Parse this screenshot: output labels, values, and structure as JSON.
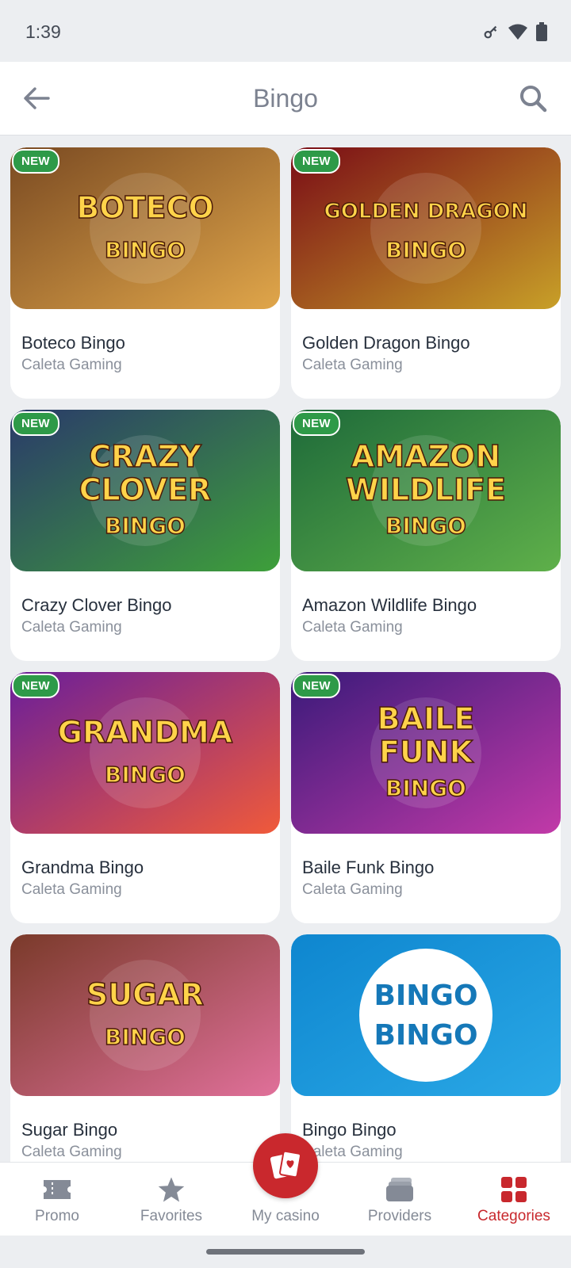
{
  "status_bar": {
    "time": "1:39"
  },
  "header": {
    "title": "Bingo"
  },
  "badge_text": "NEW",
  "games": [
    {
      "title": "Boteco Bingo",
      "provider": "Caleta Gaming",
      "new": true,
      "art_text": [
        "BOTECO",
        "BINGO"
      ],
      "colors": [
        "#7a4a22",
        "#e0a64a"
      ]
    },
    {
      "title": "Golden Dragon Bingo",
      "provider": "Caleta Gaming",
      "new": true,
      "art_text": [
        "GOLDEN DRAGON",
        "BINGO"
      ],
      "colors": [
        "#7a0c16",
        "#c8a028"
      ]
    },
    {
      "title": "Crazy Clover Bingo",
      "provider": "Caleta Gaming",
      "new": true,
      "art_text": [
        "CRAZY",
        "CLOVER",
        "BINGO"
      ],
      "colors": [
        "#2a3a6a",
        "#3ea03a"
      ]
    },
    {
      "title": "Amazon Wildlife Bingo",
      "provider": "Caleta Gaming",
      "new": true,
      "art_text": [
        "AMAZON",
        "WILDLIFE",
        "BINGO"
      ],
      "colors": [
        "#1e6a3a",
        "#5fb04a"
      ]
    },
    {
      "title": "Grandma Bingo",
      "provider": "Caleta Gaming",
      "new": true,
      "art_text": [
        "GRANDMA",
        "BINGO"
      ],
      "colors": [
        "#6a1e9a",
        "#f05a3a"
      ]
    },
    {
      "title": "Baile Funk Bingo",
      "provider": "Caleta Gaming",
      "new": true,
      "art_text": [
        "BAILE",
        "FUNK",
        "BINGO"
      ],
      "colors": [
        "#3a1a7a",
        "#c23aa8"
      ]
    },
    {
      "title": "Sugar Bingo",
      "provider": "Caleta Gaming",
      "new": false,
      "art_text": [
        "SUGAR",
        "BINGO"
      ],
      "colors": [
        "#7a3a2a",
        "#e0709a"
      ]
    },
    {
      "title": "Bingo Bingo",
      "provider": "Caleta Gaming",
      "new": false,
      "art_text": [
        "BINGO",
        "BINGO"
      ],
      "colors": [
        "#0e86cf",
        "#2aa8e6"
      ]
    }
  ],
  "nav": {
    "items": [
      {
        "label": "Promo",
        "icon": "ticket-icon"
      },
      {
        "label": "Favorites",
        "icon": "star-icon"
      },
      {
        "label": "My casino",
        "icon": "cards-icon"
      },
      {
        "label": "Providers",
        "icon": "stack-icon"
      },
      {
        "label": "Categories",
        "icon": "grid-icon"
      }
    ],
    "active": "Categories"
  },
  "theme": {
    "accent": "#c8282d",
    "badge": "#2e9a48"
  }
}
